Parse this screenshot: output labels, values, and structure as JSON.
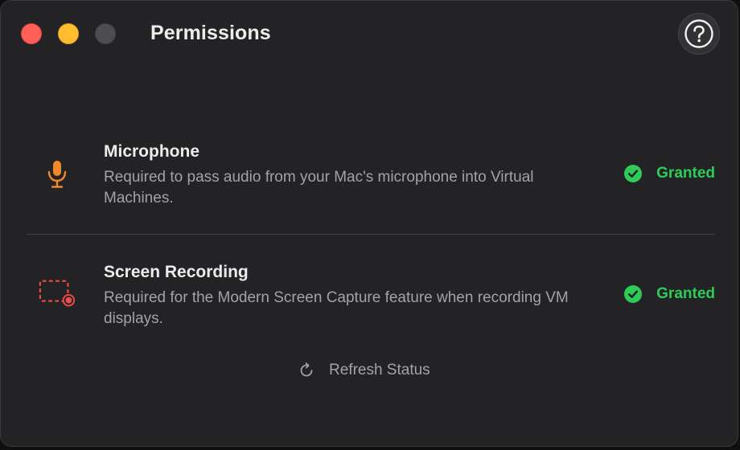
{
  "window": {
    "title": "Permissions"
  },
  "icons": {
    "help": "question-circle-icon",
    "microphone": "microphone-icon",
    "screen_recording": "screen-recording-icon",
    "granted": "checkmark-circle-icon",
    "refresh": "refresh-icon"
  },
  "colors": {
    "close": "#fe5f57",
    "minimize": "#febc2e",
    "granted": "#2fcb59",
    "microphone_icon": "#f0892c",
    "screen_icon": "#f04a4a"
  },
  "permissions": [
    {
      "title": "Microphone",
      "description": "Required to pass audio from your Mac's microphone into Virtual Machines.",
      "status": "Granted"
    },
    {
      "title": "Screen Recording",
      "description": "Required for the Modern Screen Capture feature when recording VM displays.",
      "status": "Granted"
    }
  ],
  "refresh": {
    "label": "Refresh Status"
  }
}
